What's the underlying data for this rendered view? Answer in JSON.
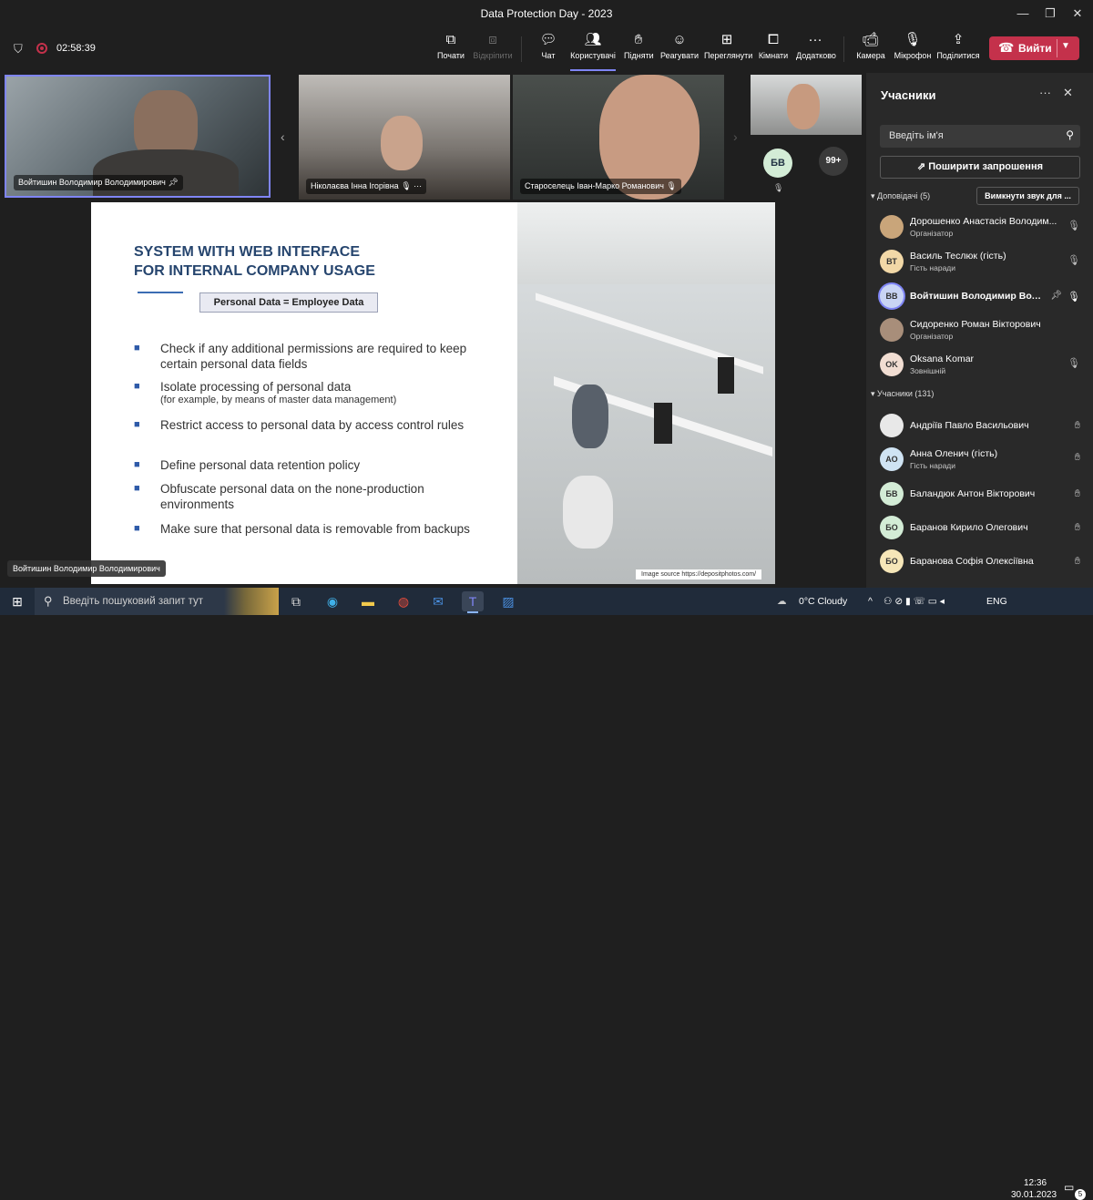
{
  "window": {
    "title": "Data Protection Day - 2023",
    "minimize_icon": "minimize-icon",
    "restore_icon": "restore-icon",
    "close_icon": "close-icon"
  },
  "meeting": {
    "timer": "02:58:39"
  },
  "toolbar": {
    "share": "Почати",
    "unpin": "Відкріпити",
    "chat": "Чат",
    "people": "Користувачі",
    "raise": "Підняти",
    "react": "Реагувати",
    "view": "Переглянути",
    "rooms": "Кімнати",
    "more": "Додатково",
    "camera": "Камера",
    "mic": "Мікрофон",
    "share_content": "Поділитися",
    "leave": "Вийти"
  },
  "videos": {
    "presenter": "Войтишин Володимир Володимирович",
    "tile2": "Ніколаєва Інна Ігорівна",
    "tile3": "Староселець Іван-Марко Романович",
    "avatar_initials": "БВ",
    "overflow": "99+"
  },
  "slide": {
    "title_line1": "SYSTEM WITH WEB INTERFACE",
    "title_line2": "FOR INTERNAL COMPANY USAGE",
    "tag": "Personal Data = Employee Data",
    "bullets": [
      {
        "main": "Check if any additional permissions are required to keep certain personal data fields",
        "sub": ""
      },
      {
        "main": "Isolate processing of personal data",
        "sub": "(for example, by means of master data management)"
      },
      {
        "main": "Restrict access to personal data by access control rules",
        "sub": ""
      },
      {
        "main": "Define personal data retention policy",
        "sub": ""
      },
      {
        "main": "Obfuscate personal data on the none-production environments",
        "sub": ""
      },
      {
        "main": "Make sure that personal data is removable from backups",
        "sub": ""
      }
    ],
    "image_credit": "Image source https://depositphotos.com/",
    "presenter_label": "Войтишин Володимир Володимирович"
  },
  "panel": {
    "title": "Учасники",
    "search_placeholder": "Введіть ім'я",
    "share_invite": "Поширити запрошення",
    "presenters_header": "Доповідачі (5)",
    "mute_all": "Вимкнути звук для ...",
    "attendees_header": "Учасники (131)",
    "presenters": [
      {
        "initials": "",
        "name": "Дорошенко Анастасія Володим...",
        "role": "Організатор",
        "color": "#c9a57a",
        "bold": false
      },
      {
        "initials": "ВТ",
        "name": "Василь Теслюк (гість)",
        "role": "Гість наради",
        "color": "#f2d8a7",
        "bold": false
      },
      {
        "initials": "ВВ",
        "name": "Войтишин Володимир Вол...",
        "role": "",
        "color": "#c9d4f4",
        "bold": true
      },
      {
        "initials": "",
        "name": "Сидоренко Роман Вікторович",
        "role": "Організатор",
        "color": "#a88e7a",
        "bold": false
      },
      {
        "initials": "OK",
        "name": "Oksana Komar",
        "role": "Зовнішній",
        "color": "#f1ddd2",
        "bold": false
      }
    ],
    "attendees": [
      {
        "initials": "",
        "name": "Андріїв Павло Васильович",
        "role": "",
        "color": "#e8e8e8"
      },
      {
        "initials": "АО",
        "name": "Анна Оленич (гість)",
        "role": "Гість наради",
        "color": "#cfe3f3"
      },
      {
        "initials": "БВ",
        "name": "Баландюк Антон Вікторович",
        "role": "",
        "color": "#d3ecd6"
      },
      {
        "initials": "БО",
        "name": "Баранов Кирило Олегович",
        "role": "",
        "color": "#d3ecd6"
      },
      {
        "initials": "БО",
        "name": "Баранова Софія Олексіївна",
        "role": "",
        "color": "#f6e6b8"
      }
    ]
  },
  "taskbar": {
    "search_placeholder": "Введіть пошуковий запит тут",
    "weather": "0°C  Cloudy",
    "lang": "ENG",
    "time": "12:36",
    "date": "30.01.2023",
    "notifications": "5"
  }
}
